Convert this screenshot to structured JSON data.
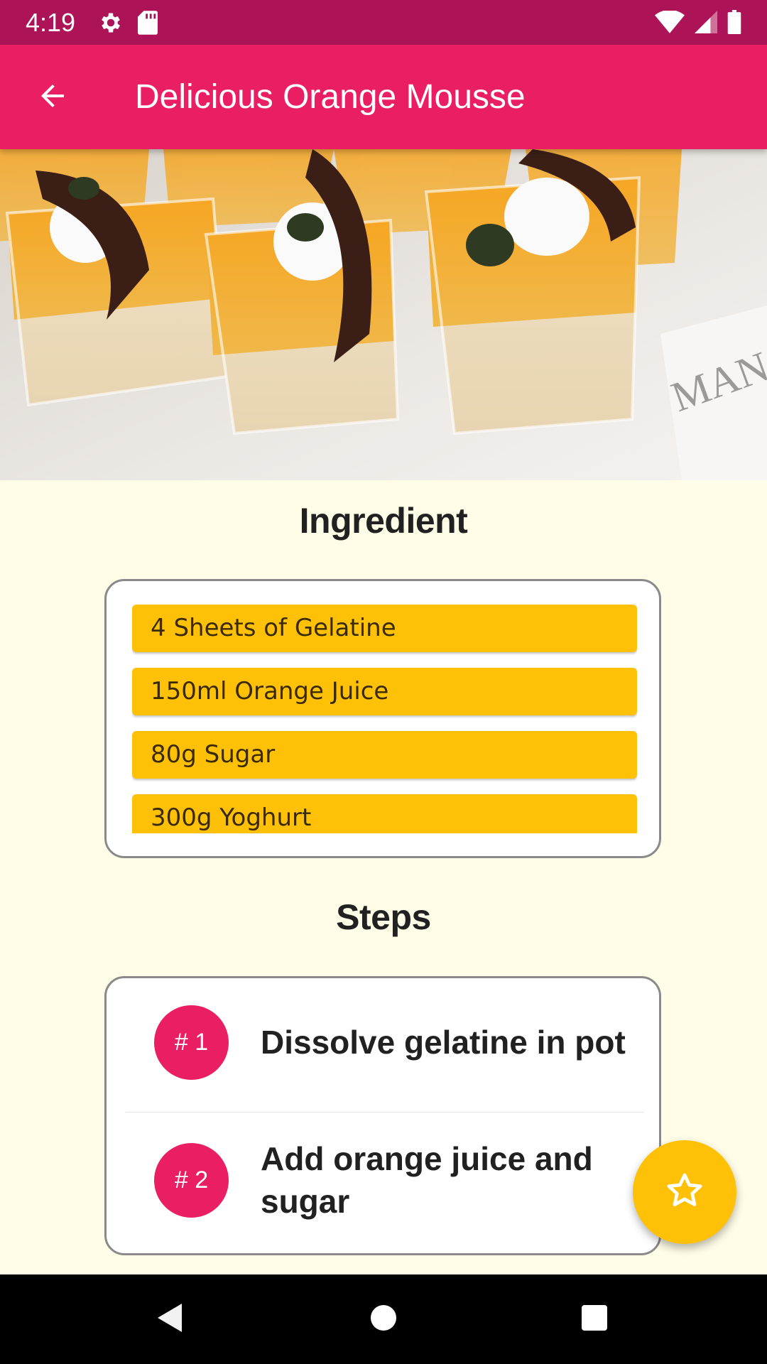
{
  "status_bar": {
    "time": "4:19",
    "icons": [
      "settings-icon",
      "sd-card-icon",
      "wifi-icon",
      "signal-icon",
      "battery-icon"
    ]
  },
  "app_bar": {
    "title": "Delicious Orange Mousse",
    "back_icon": "arrow-back-icon",
    "background": "#E91E63"
  },
  "hero_image": {
    "description": "mousse-cups-photo"
  },
  "ingredients": {
    "title": "Ingredient",
    "items": [
      "4 Sheets of Gelatine",
      "150ml Orange Juice",
      "80g Sugar",
      "300g Yoghurt"
    ],
    "item_color": "#FFC107"
  },
  "steps": {
    "title": "Steps",
    "items": [
      {
        "badge": "# 1",
        "text": "Dissolve gelatine in pot"
      },
      {
        "badge": "# 2",
        "text": "Add orange juice and sugar"
      }
    ],
    "badge_color": "#E91E63"
  },
  "fab": {
    "icon": "star-outline-icon",
    "color": "#FFC107"
  },
  "nav_bar": {
    "icons": [
      "back-triangle-icon",
      "home-circle-icon",
      "recents-square-icon"
    ]
  },
  "colors": {
    "status_bar": "#AD1457",
    "page_background": "#FFFDE7"
  }
}
